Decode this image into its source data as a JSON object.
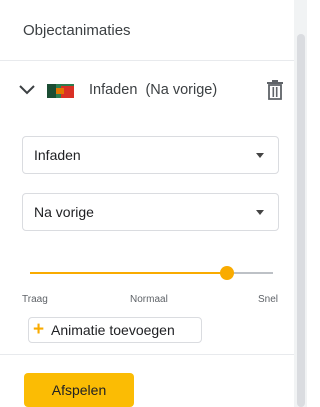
{
  "panel": {
    "title": "Objectanimaties"
  },
  "animation_item": {
    "effect": "Infaden",
    "trigger_suffix": "(Na vorige)"
  },
  "effect_select": {
    "value": "Infaden"
  },
  "trigger_select": {
    "value": "Na vorige"
  },
  "speed_slider": {
    "value_fraction": 0.81,
    "labels": {
      "slow": "Traag",
      "normal": "Normaal",
      "fast": "Snel"
    }
  },
  "add_button": {
    "icon": "plus-icon",
    "label": "Animatie toevoegen"
  },
  "play_button": {
    "label": "Afspelen"
  },
  "colors": {
    "accent": "#f9ab00",
    "play_button": "#fbbc04",
    "border": "#dadce0",
    "text": "#202124",
    "muted": "#5f6368"
  }
}
